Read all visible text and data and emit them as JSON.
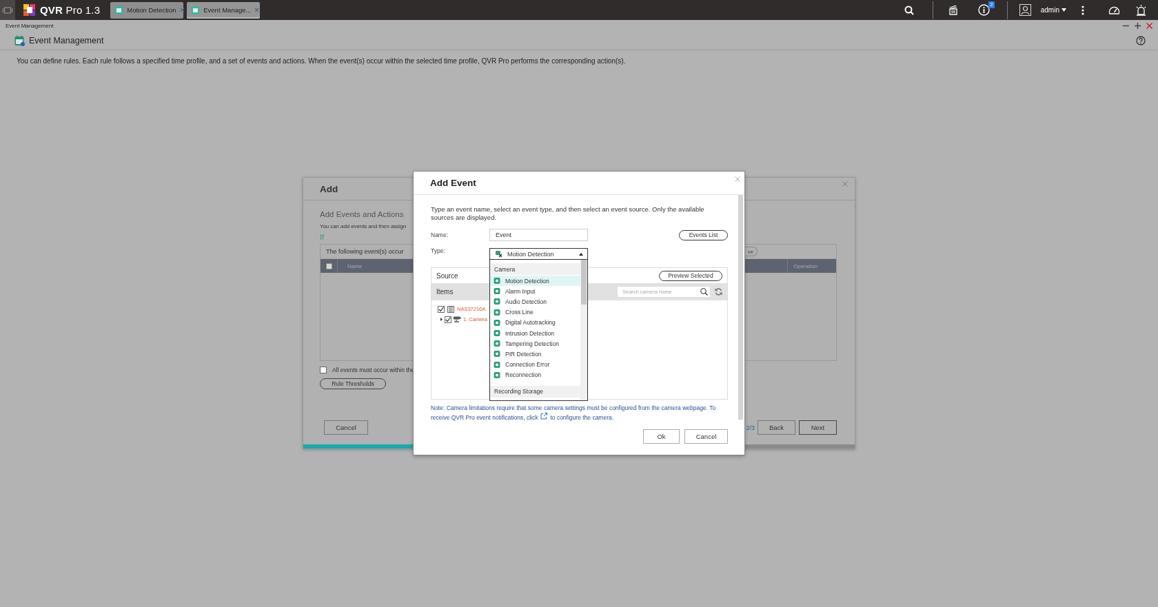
{
  "topbar": {
    "app_name": "**QVR** Pro 1.3",
    "tabs": [
      {
        "label": "Motion Detection",
        "selected": false
      },
      {
        "label": "Event Manage...",
        "selected": true
      }
    ],
    "notification_count": "2",
    "user": "admin"
  },
  "window": {
    "breadcrumb": "Event Management",
    "title": "Event Management",
    "description": "You can define rules. Each rule follows a specified time profile, and a set of events and actions. When the event(s) occur within the selected time profile, QVR Pro performs the corresponding action(s)."
  },
  "add_dialog": {
    "title": "Add",
    "section_title": "Add Events and Actions",
    "section_text": "You can add events and then assign",
    "condition_label": "If",
    "events_toolbar_label": "The following event(s) occur",
    "toolbar_button": "ve",
    "select_all_checked": false,
    "columns": [
      "Name",
      "Operation"
    ],
    "all_events_option": {
      "label": "All events must occur within the",
      "checked": false
    },
    "rule_thresholds_button": "Rule Thresholds",
    "cancel_button": "Cancel",
    "step": "2/3",
    "progress": {
      "level": 0.67
    },
    "back_button": "Back",
    "next_button": "Next"
  },
  "add_event_dialog": {
    "title": "Add Event",
    "description": "Type an event name, select an event type, and then select an event source. Only the available sources are displayed.",
    "name_label": "Name:",
    "name_value": "Event",
    "events_list_button": "Events List",
    "type_label": "Type:",
    "type_value": "Motion Detection",
    "type_options": [
      {
        "group": "Camera",
        "items": [
          {
            "label": "Motion Detection",
            "selected": true
          },
          {
            "label": "Alarm Input",
            "selected": false
          },
          {
            "label": "Audio Detection",
            "selected": false
          },
          {
            "label": "Cross Line",
            "selected": false
          },
          {
            "label": "Digital Autotracking",
            "selected": false
          },
          {
            "label": "Intrusion Detection",
            "selected": false
          },
          {
            "label": "Tampering Detection",
            "selected": false
          },
          {
            "label": "PIR Detection",
            "selected": false
          },
          {
            "label": "Connection Error",
            "selected": false
          },
          {
            "label": "Reconnection",
            "selected": false
          }
        ]
      },
      {
        "group": "Recording Storage"
      }
    ],
    "source": {
      "title": "Source",
      "preview_button": "Preview Selected",
      "items_label": "Items",
      "search_placeholder": "Search camera name",
      "tree": [
        {
          "label": "NAS37216A",
          "checked": true,
          "children": [
            {
              "label": "1. Camera",
              "checked": true
            }
          ]
        }
      ]
    },
    "note_line_1": "Note: Camera limitations require that some camera settings must be configured from the camera webpage. To",
    "note_line_2_before": "receive QVR Pro event notifications, click",
    "note_line_2_after": "to configure the camera.",
    "ok_button": "Ok",
    "cancel_button": "Cancel"
  }
}
